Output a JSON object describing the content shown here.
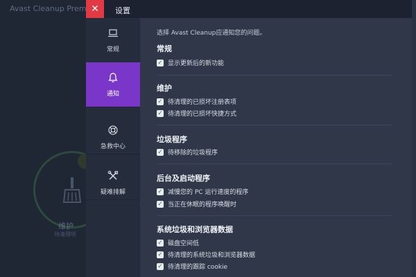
{
  "background": {
    "app_title": "Avast Cleanup Premiu",
    "maint_label": "维护",
    "maint_sublabel": "待清理项"
  },
  "topbar": {
    "close_glyph": "✕",
    "title": "设置"
  },
  "sidebar": {
    "items": [
      {
        "label": "常规",
        "icon": "laptop-icon",
        "active": false
      },
      {
        "label": "通知",
        "icon": "bell-icon",
        "active": true
      },
      {
        "label": "急救中心",
        "icon": "lifebuoy-icon",
        "active": false
      },
      {
        "label": "疑难排解",
        "icon": "tools-icon",
        "active": false
      }
    ]
  },
  "content": {
    "intro": "选择 Avast Cleanup应通知您的问题。",
    "sections": [
      {
        "title": "常规",
        "items": [
          "显示更新后的新功能"
        ]
      },
      {
        "title": "维护",
        "items": [
          "待清理的已损坏注册表项",
          "待清理的已损坏快捷方式"
        ]
      },
      {
        "title": "垃圾程序",
        "items": [
          "待移除的垃圾程序"
        ]
      },
      {
        "title": "后台及启动程序",
        "items": [
          "减慢您的 PC 运行速度的程序",
          "当正在休眠的程序唤醒时"
        ]
      },
      {
        "title": "系统垃圾和浏览器数据",
        "items": [
          "磁盘空间低",
          "待清理的系统垃圾和浏览器数据",
          "待清理的跟踪 cookie"
        ]
      }
    ]
  },
  "colors": {
    "accent": "#7a35c9",
    "close": "#e23a45",
    "check": "#1f8a4c"
  }
}
